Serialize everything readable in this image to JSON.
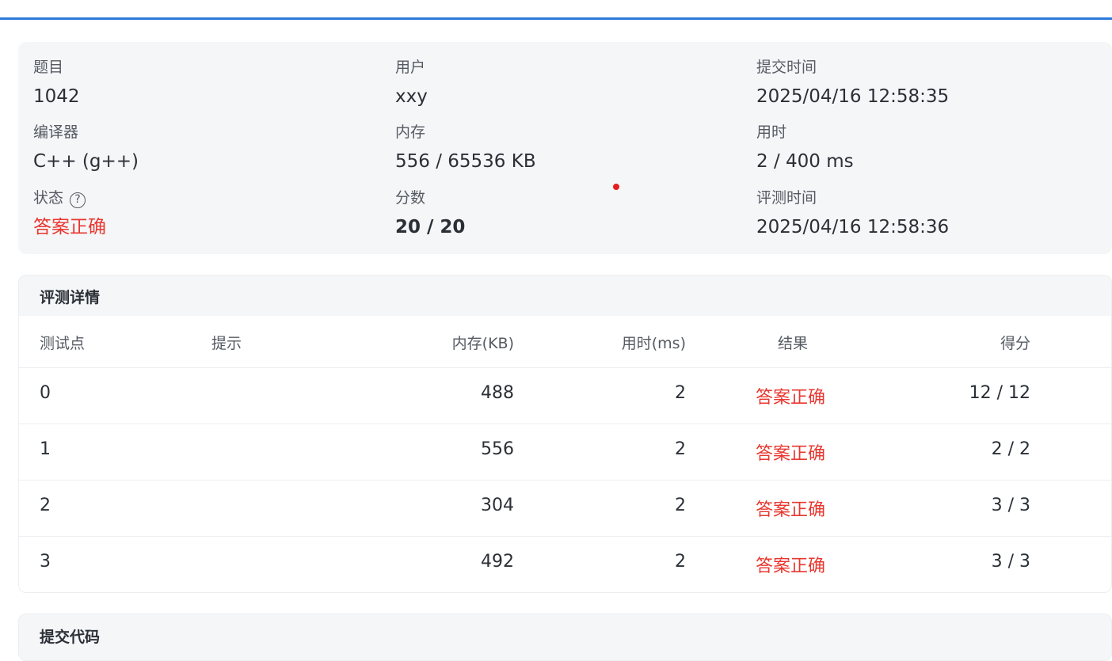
{
  "info": {
    "problem": {
      "label": "题目",
      "value": "1042"
    },
    "user": {
      "label": "用户",
      "value": "xxy"
    },
    "submit_time": {
      "label": "提交时间",
      "value": "2025/04/16 12:58:35"
    },
    "compiler": {
      "label": "编译器",
      "value": "C++ (g++)"
    },
    "memory": {
      "label": "内存",
      "value": "556 / 65536 KB"
    },
    "time_used": {
      "label": "用时",
      "value": "2 / 400 ms"
    },
    "status": {
      "label": "状态",
      "value": "答案正确",
      "help_icon": "question-circle-icon"
    },
    "score": {
      "label": "分数",
      "value": "20 / 20"
    },
    "judge_time": {
      "label": "评测时间",
      "value": "2025/04/16 12:58:36"
    }
  },
  "details": {
    "title": "评测详情",
    "headers": {
      "case": "测试点",
      "hint": "提示",
      "memory": "内存(KB)",
      "time": "用时(ms)",
      "result": "结果",
      "score": "得分"
    },
    "rows": [
      {
        "case": "0",
        "hint": "",
        "memory": "488",
        "time": "2",
        "result": "答案正确",
        "score": "12 / 12"
      },
      {
        "case": "1",
        "hint": "",
        "memory": "556",
        "time": "2",
        "result": "答案正确",
        "score": "2 / 2"
      },
      {
        "case": "2",
        "hint": "",
        "memory": "304",
        "time": "2",
        "result": "答案正确",
        "score": "3 / 3"
      },
      {
        "case": "3",
        "hint": "",
        "memory": "492",
        "time": "2",
        "result": "答案正确",
        "score": "3 / 3"
      }
    ]
  },
  "code_section": {
    "title": "提交代码"
  },
  "colors": {
    "accent": "#2b7bdc",
    "success_text": "#e8372f",
    "panel_bg": "#f5f6f8"
  }
}
